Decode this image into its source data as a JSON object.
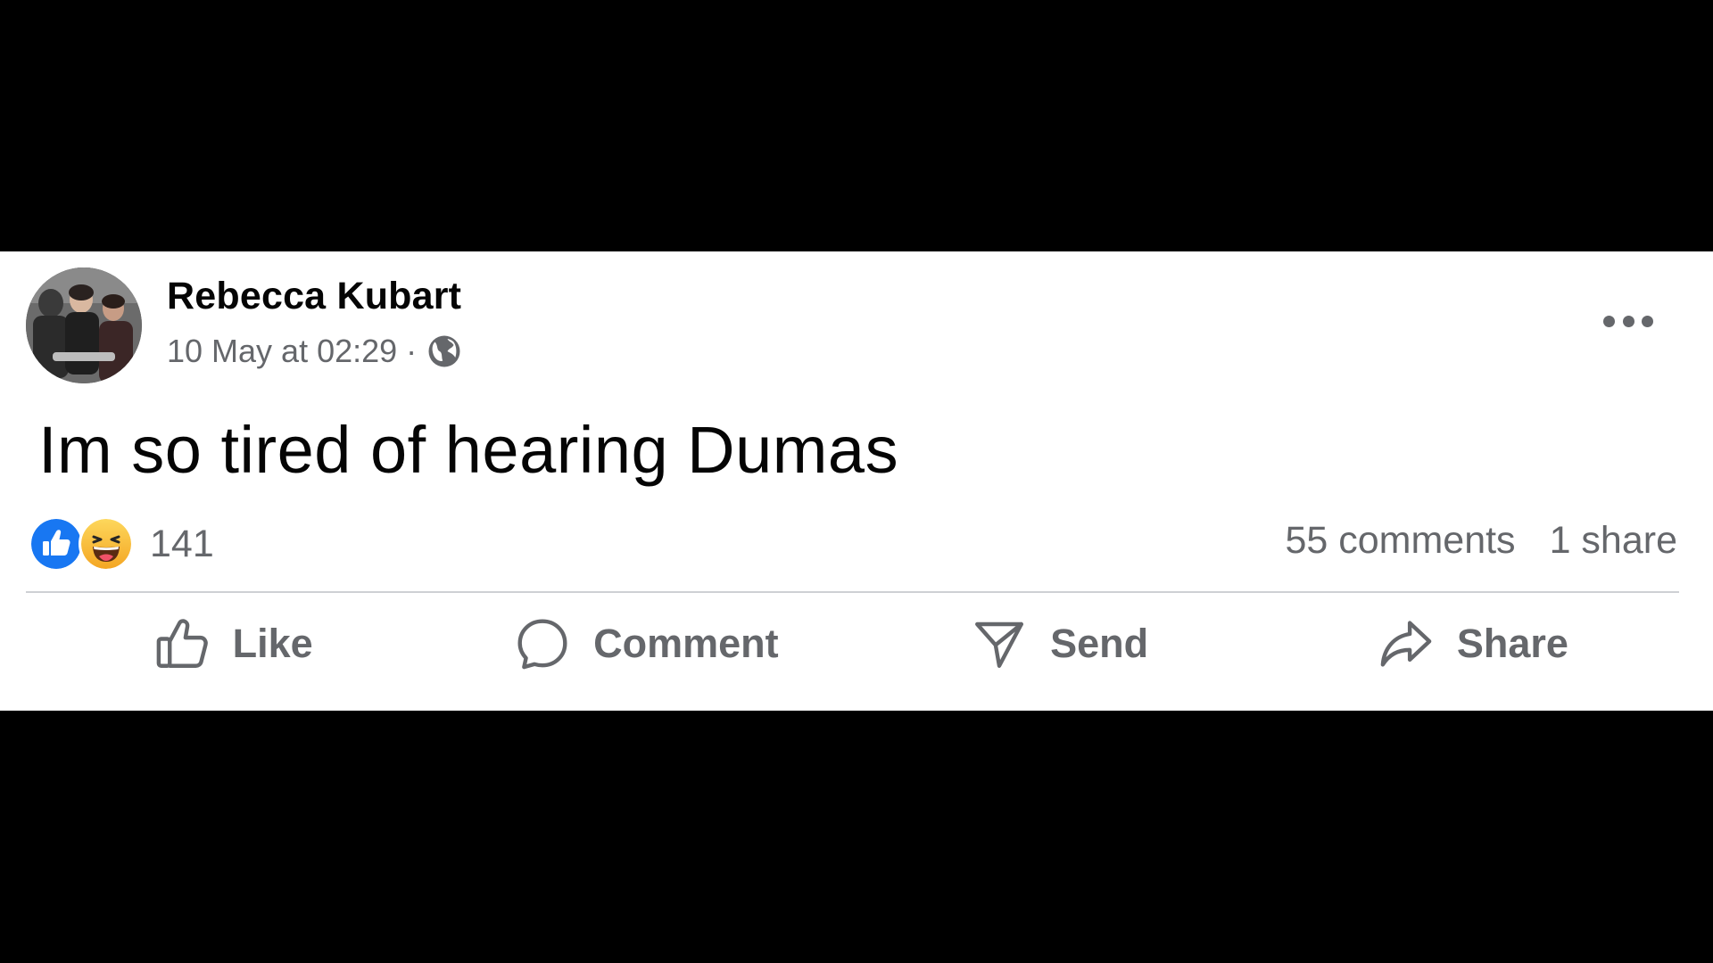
{
  "post": {
    "author": "Rebecca Kubart",
    "timestamp": "10 May at 02:29",
    "separator": "·",
    "privacy_icon": "globe-icon",
    "text": "Im so tired of hearing Dumas",
    "reactions": {
      "icons": [
        "like-icon",
        "haha-icon"
      ],
      "count": "141"
    },
    "comments_label": "55 comments",
    "shares_label": "1 share"
  },
  "actions": {
    "like": "Like",
    "comment": "Comment",
    "send": "Send",
    "share": "Share"
  },
  "colors": {
    "background": "#000000",
    "card": "#ffffff",
    "text_primary": "#050505",
    "text_secondary": "#65676b",
    "like_blue": "#1877f2",
    "haha_yellow": "#f7b125"
  }
}
